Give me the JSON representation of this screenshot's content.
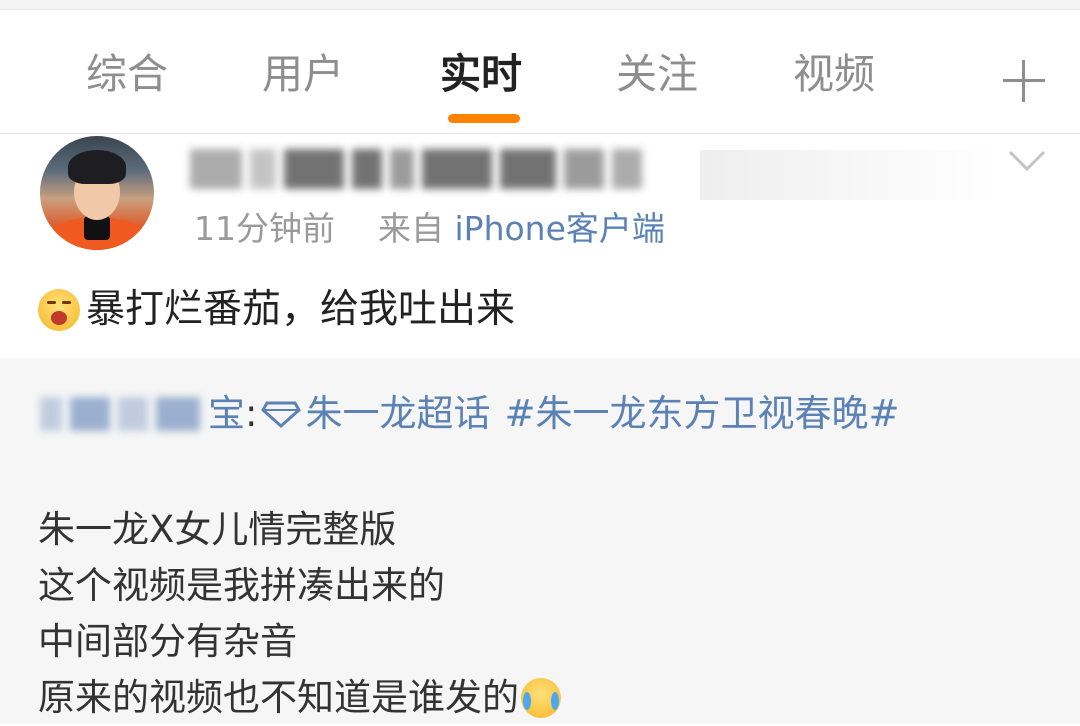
{
  "tabs": [
    {
      "label": "综合",
      "active": false
    },
    {
      "label": "用户",
      "active": false
    },
    {
      "label": "实时",
      "active": true
    },
    {
      "label": "关注",
      "active": false
    },
    {
      "label": "视频",
      "active": false
    }
  ],
  "tab_add_icon": "plus-icon",
  "accent_color": "#ff8200",
  "link_color": "#5b82b5",
  "post": {
    "time": "11分钟前",
    "from_label": "来自",
    "source": "iPhone客户端",
    "text": "暴打烂番茄，给我吐出来",
    "emoji": "scream-emoji"
  },
  "repost": {
    "author_suffix": "宝",
    "colon": ":",
    "super_topic_icon": "diamond-icon",
    "super_topic": "朱一龙超话",
    "hashtag": "#朱一龙东方卫视春晚#",
    "body_lines": [
      "朱一龙X女儿情完整版",
      "这个视频是我拼凑出来的",
      "中间部分有杂音",
      "原来的视频也不知道是谁发的"
    ],
    "trailing_emoji": "laugh-cry-emoji"
  }
}
